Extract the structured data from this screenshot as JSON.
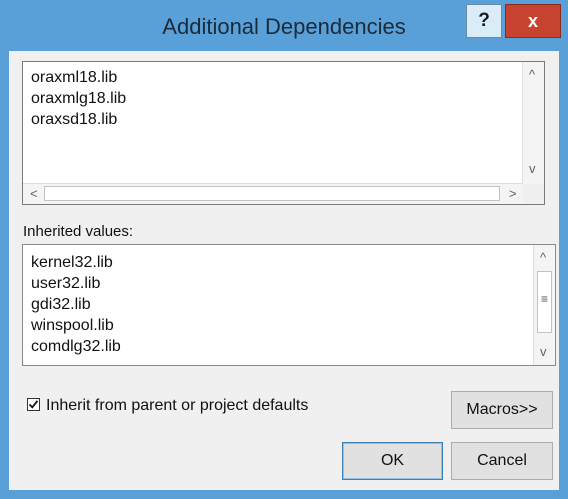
{
  "window": {
    "title": "Additional Dependencies",
    "help_label": "?",
    "close_label": "x"
  },
  "editor": {
    "lines": [
      "oraxml18.lib",
      "oraxmlg18.lib",
      "oraxsd18.lib"
    ],
    "scroll_up": "^",
    "scroll_down": "v",
    "scroll_left": "<",
    "scroll_right": ">"
  },
  "inherited": {
    "label": "Inherited values:",
    "items": [
      "kernel32.lib",
      "user32.lib",
      "gdi32.lib",
      "winspool.lib",
      "comdlg32.lib"
    ],
    "scroll_up": "^",
    "scroll_down": "v",
    "thumb_grip": "≡"
  },
  "inherit_checkbox": {
    "label": "Inherit from parent or project defaults",
    "checked": true
  },
  "buttons": {
    "macros": "Macros>>",
    "ok": "OK",
    "cancel": "Cancel"
  }
}
